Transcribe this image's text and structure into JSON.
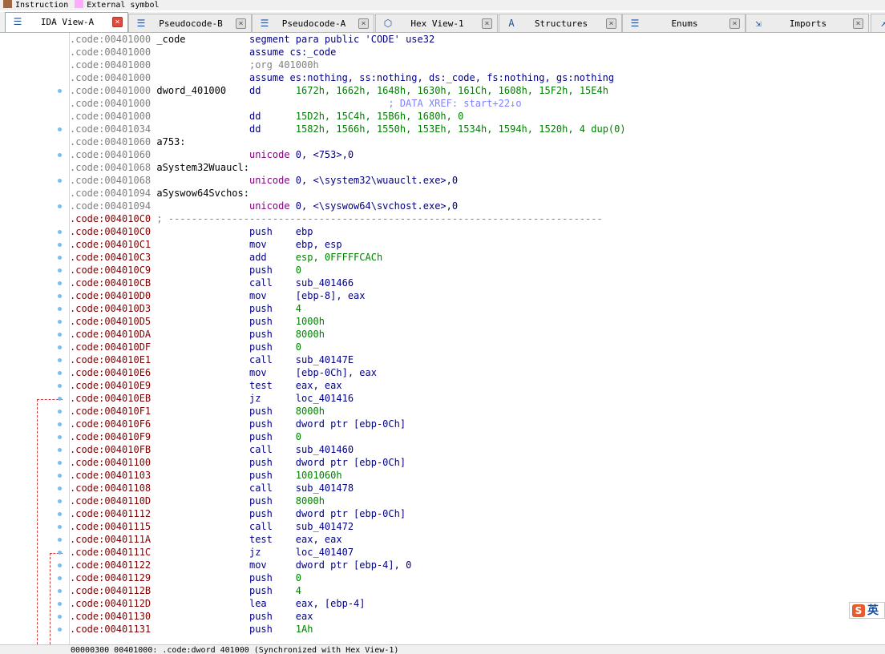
{
  "legend": {
    "items": [
      {
        "label": "Instruction",
        "color": "#a06840"
      },
      {
        "label": "External symbol",
        "color": "#ffaaff"
      }
    ]
  },
  "tabs": [
    {
      "label": "IDA View-A",
      "icon": "ida-view-icon",
      "active": true
    },
    {
      "label": "Pseudocode-B",
      "icon": "pseudocode-icon",
      "active": false
    },
    {
      "label": "Pseudocode-A",
      "icon": "pseudocode-icon",
      "active": false
    },
    {
      "label": "Hex View-1",
      "icon": "hex-view-icon",
      "active": false
    },
    {
      "label": "Structures",
      "icon": "structures-icon",
      "active": false
    },
    {
      "label": "Enums",
      "icon": "enums-icon",
      "active": false
    },
    {
      "label": "Imports",
      "icon": "imports-icon",
      "active": false
    },
    {
      "label": "",
      "icon": "exports-icon",
      "active": false
    }
  ],
  "listing": [
    {
      "addr": ".code:00401000",
      "ac": "gray",
      "dot": false,
      "name": "_code",
      "op": "segment para public 'CODE' use32",
      "args": "",
      "comment": ""
    },
    {
      "addr": ".code:00401000",
      "ac": "gray",
      "dot": false,
      "name": "",
      "op": "assume cs:_code",
      "args": "",
      "comment": ""
    },
    {
      "addr": ".code:00401000",
      "ac": "gray",
      "dot": false,
      "name": "",
      "op": ";org 401000h",
      "args": "",
      "comment": "",
      "opcls": "c-gray"
    },
    {
      "addr": ".code:00401000",
      "ac": "gray",
      "dot": false,
      "name": "",
      "op": "assume es:nothing, ss:nothing, ds:_code, fs:nothing, gs:nothing",
      "args": "",
      "comment": ""
    },
    {
      "addr": ".code:00401000",
      "ac": "gray",
      "dot": true,
      "name": "dword_401000",
      "op": "dd",
      "args": "1672h, 1662h, 1648h, 1630h, 161Ch, 1608h, 15F2h, 15E4h",
      "comment": ""
    },
    {
      "addr": ".code:00401000",
      "ac": "gray",
      "dot": false,
      "name": "",
      "op": "",
      "args": "",
      "comment": "                        ; DATA XREF: start+22↓o"
    },
    {
      "addr": ".code:00401000",
      "ac": "gray",
      "dot": false,
      "name": "",
      "op": "dd",
      "args": "15D2h, 15C4h, 15B6h, 1680h, 0",
      "comment": ""
    },
    {
      "addr": ".code:00401034",
      "ac": "gray",
      "dot": true,
      "name": "",
      "op": "dd",
      "args": "1582h, 1566h, 1550h, 153Eh, 1534h, 1594h, 1520h, 4 dup(0)",
      "comment": ""
    },
    {
      "addr": ".code:00401060",
      "ac": "gray",
      "dot": false,
      "name": "a753:",
      "op": "",
      "args": "",
      "comment": ""
    },
    {
      "addr": ".code:00401060",
      "ac": "gray",
      "dot": true,
      "name": "",
      "op": "unicode",
      "args": "0, <753>,0",
      "comment": "",
      "opcls": "c-uni"
    },
    {
      "addr": ".code:00401068",
      "ac": "gray",
      "dot": false,
      "name": "aSystem32Wuaucl:",
      "op": "",
      "args": "",
      "comment": ""
    },
    {
      "addr": ".code:00401068",
      "ac": "gray",
      "dot": true,
      "name": "",
      "op": "unicode",
      "args": "0, <\\system32\\wuauclt.exe>,0",
      "comment": "",
      "opcls": "c-uni"
    },
    {
      "addr": ".code:00401094",
      "ac": "gray",
      "dot": false,
      "name": "aSyswow64Svchos:",
      "op": "",
      "args": "",
      "comment": ""
    },
    {
      "addr": ".code:00401094",
      "ac": "gray",
      "dot": true,
      "name": "",
      "op": "unicode",
      "args": "0, <\\syswow64\\svchost.exe>,0",
      "comment": "",
      "opcls": "c-uni"
    },
    {
      "addr": ".code:004010C0",
      "ac": "red",
      "dot": false,
      "name": "; ---------------------------------------------------------------------------",
      "op": "",
      "args": "",
      "comment": "",
      "namecls": "c-gray"
    },
    {
      "addr": ".code:004010C0",
      "ac": "red",
      "dot": true,
      "name": "",
      "op": "push",
      "args": "ebp",
      "comment": ""
    },
    {
      "addr": ".code:004010C1",
      "ac": "red",
      "dot": true,
      "name": "",
      "op": "mov",
      "args": "ebp, esp",
      "comment": ""
    },
    {
      "addr": ".code:004010C3",
      "ac": "red",
      "dot": true,
      "name": "",
      "op": "add",
      "args": "esp, 0FFFFFCACh",
      "comment": "",
      "argcls": "num"
    },
    {
      "addr": ".code:004010C9",
      "ac": "red",
      "dot": true,
      "name": "",
      "op": "push",
      "args": "0",
      "comment": "",
      "argcls": "num"
    },
    {
      "addr": ".code:004010CB",
      "ac": "red",
      "dot": true,
      "name": "",
      "op": "call",
      "args": "sub_401466",
      "comment": ""
    },
    {
      "addr": ".code:004010D0",
      "ac": "red",
      "dot": true,
      "name": "",
      "op": "mov",
      "args": "[ebp-8], eax",
      "comment": ""
    },
    {
      "addr": ".code:004010D3",
      "ac": "red",
      "dot": true,
      "name": "",
      "op": "push",
      "args": "4",
      "comment": "",
      "argcls": "num"
    },
    {
      "addr": ".code:004010D5",
      "ac": "red",
      "dot": true,
      "name": "",
      "op": "push",
      "args": "1000h",
      "comment": "",
      "argcls": "num"
    },
    {
      "addr": ".code:004010DA",
      "ac": "red",
      "dot": true,
      "name": "",
      "op": "push",
      "args": "8000h",
      "comment": "",
      "argcls": "num"
    },
    {
      "addr": ".code:004010DF",
      "ac": "red",
      "dot": true,
      "name": "",
      "op": "push",
      "args": "0",
      "comment": "",
      "argcls": "num"
    },
    {
      "addr": ".code:004010E1",
      "ac": "red",
      "dot": true,
      "name": "",
      "op": "call",
      "args": "sub_40147E",
      "comment": ""
    },
    {
      "addr": ".code:004010E6",
      "ac": "red",
      "dot": true,
      "name": "",
      "op": "mov",
      "args": "[ebp-0Ch], eax",
      "comment": ""
    },
    {
      "addr": ".code:004010E9",
      "ac": "red",
      "dot": true,
      "name": "",
      "op": "test",
      "args": "eax, eax",
      "comment": ""
    },
    {
      "addr": ".code:004010EB",
      "ac": "red",
      "dot": true,
      "name": "",
      "op": "jz",
      "args": "loc_401416",
      "comment": ""
    },
    {
      "addr": ".code:004010F1",
      "ac": "red",
      "dot": true,
      "name": "",
      "op": "push",
      "args": "8000h",
      "comment": "",
      "argcls": "num"
    },
    {
      "addr": ".code:004010F6",
      "ac": "red",
      "dot": true,
      "name": "",
      "op": "push",
      "args": "dword ptr [ebp-0Ch]",
      "comment": ""
    },
    {
      "addr": ".code:004010F9",
      "ac": "red",
      "dot": true,
      "name": "",
      "op": "push",
      "args": "0",
      "comment": "",
      "argcls": "num"
    },
    {
      "addr": ".code:004010FB",
      "ac": "red",
      "dot": true,
      "name": "",
      "op": "call",
      "args": "sub_401460",
      "comment": ""
    },
    {
      "addr": ".code:00401100",
      "ac": "red",
      "dot": true,
      "name": "",
      "op": "push",
      "args": "dword ptr [ebp-0Ch]",
      "comment": ""
    },
    {
      "addr": ".code:00401103",
      "ac": "red",
      "dot": true,
      "name": "",
      "op": "push",
      "args": "1001060h",
      "comment": "",
      "argcls": "num"
    },
    {
      "addr": ".code:00401108",
      "ac": "red",
      "dot": true,
      "name": "",
      "op": "call",
      "args": "sub_401478",
      "comment": ""
    },
    {
      "addr": ".code:0040110D",
      "ac": "red",
      "dot": true,
      "name": "",
      "op": "push",
      "args": "8000h",
      "comment": "",
      "argcls": "num"
    },
    {
      "addr": ".code:00401112",
      "ac": "red",
      "dot": true,
      "name": "",
      "op": "push",
      "args": "dword ptr [ebp-0Ch]",
      "comment": ""
    },
    {
      "addr": ".code:00401115",
      "ac": "red",
      "dot": true,
      "name": "",
      "op": "call",
      "args": "sub_401472",
      "comment": ""
    },
    {
      "addr": ".code:0040111A",
      "ac": "red",
      "dot": true,
      "name": "",
      "op": "test",
      "args": "eax, eax",
      "comment": ""
    },
    {
      "addr": ".code:0040111C",
      "ac": "red",
      "dot": true,
      "name": "",
      "op": "jz",
      "args": "loc_401407",
      "comment": ""
    },
    {
      "addr": ".code:00401122",
      "ac": "red",
      "dot": true,
      "name": "",
      "op": "mov",
      "args": "dword ptr [ebp-4], 0",
      "comment": ""
    },
    {
      "addr": ".code:00401129",
      "ac": "red",
      "dot": true,
      "name": "",
      "op": "push",
      "args": "0",
      "comment": "",
      "argcls": "num"
    },
    {
      "addr": ".code:0040112B",
      "ac": "red",
      "dot": true,
      "name": "",
      "op": "push",
      "args": "4",
      "comment": "",
      "argcls": "num"
    },
    {
      "addr": ".code:0040112D",
      "ac": "red",
      "dot": true,
      "name": "",
      "op": "lea",
      "args": "eax, [ebp-4]",
      "comment": ""
    },
    {
      "addr": ".code:00401130",
      "ac": "red",
      "dot": true,
      "name": "",
      "op": "push",
      "args": "eax",
      "comment": ""
    },
    {
      "addr": ".code:00401131",
      "ac": "red",
      "dot": true,
      "name": "",
      "op": "push",
      "args": "1Ah",
      "comment": "",
      "argcls": "num"
    }
  ],
  "status": {
    "text": "00000300 00401000: .code:dword_401000 (Synchronized with Hex View-1)"
  },
  "ime": {
    "logo": "S",
    "lang": "英"
  }
}
